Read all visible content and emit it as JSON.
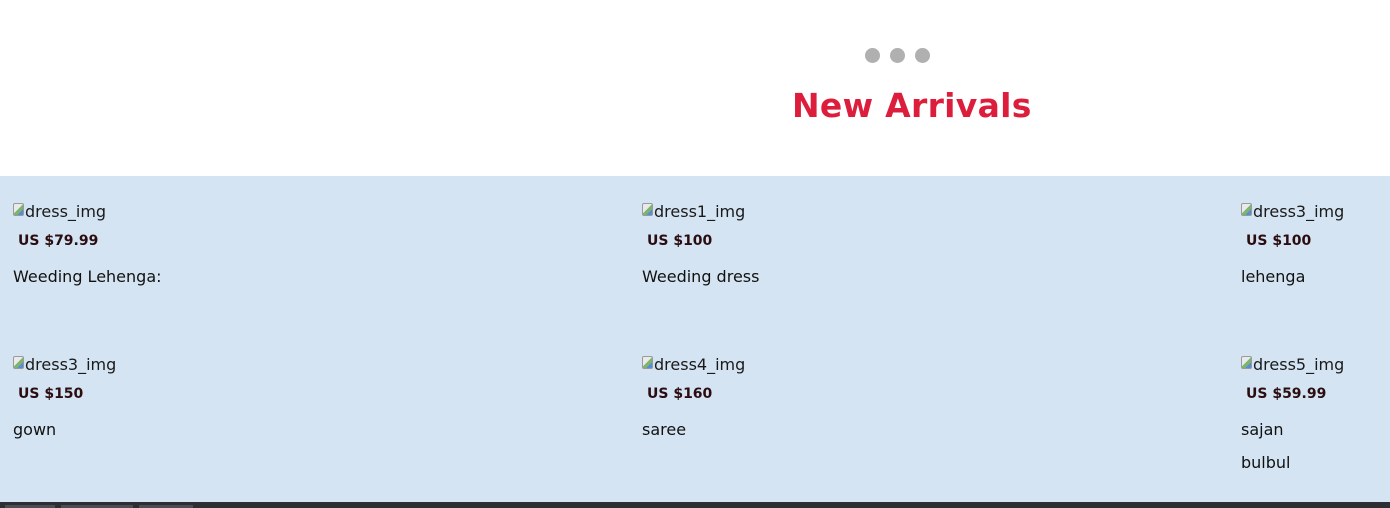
{
  "section": {
    "title": "New Arrivals",
    "carousel_dots": 3,
    "colors": {
      "title": "#dc1e3c",
      "panel_bg": "#d4e4f3",
      "dot": "#b0b0b0",
      "price": "#2b0d10"
    }
  },
  "products": [
    {
      "img_alt": "dress_img",
      "price": "US $79.99",
      "name": "Weeding Lehenga:"
    },
    {
      "img_alt": "dress1_img",
      "price": "US $100",
      "name": "Weeding dress"
    },
    {
      "img_alt": "dress3_img",
      "price": "US $100",
      "name": "lehenga"
    },
    {
      "img_alt": "dress3_img",
      "price": "US $150",
      "name": "gown"
    },
    {
      "img_alt": "dress4_img",
      "price": "US $160",
      "name": "saree"
    },
    {
      "img_alt": "dress5_img",
      "price": "US $59.99",
      "name": "sajan",
      "extra": "bulbul"
    }
  ]
}
